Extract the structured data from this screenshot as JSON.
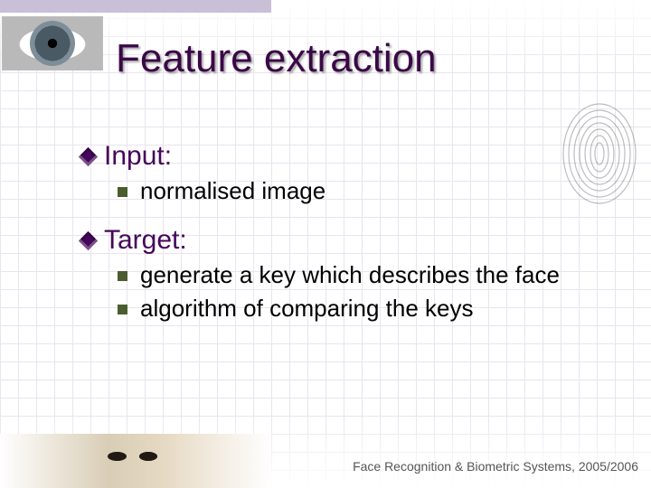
{
  "title": "Feature extraction",
  "sections": [
    {
      "heading": "Input:",
      "items": [
        "normalised image"
      ]
    },
    {
      "heading": "Target:",
      "items": [
        "generate a key which describes the face",
        "algorithm of comparing the keys"
      ]
    }
  ],
  "footer": "Face Recognition & Biometric Systems, 2005/2006"
}
